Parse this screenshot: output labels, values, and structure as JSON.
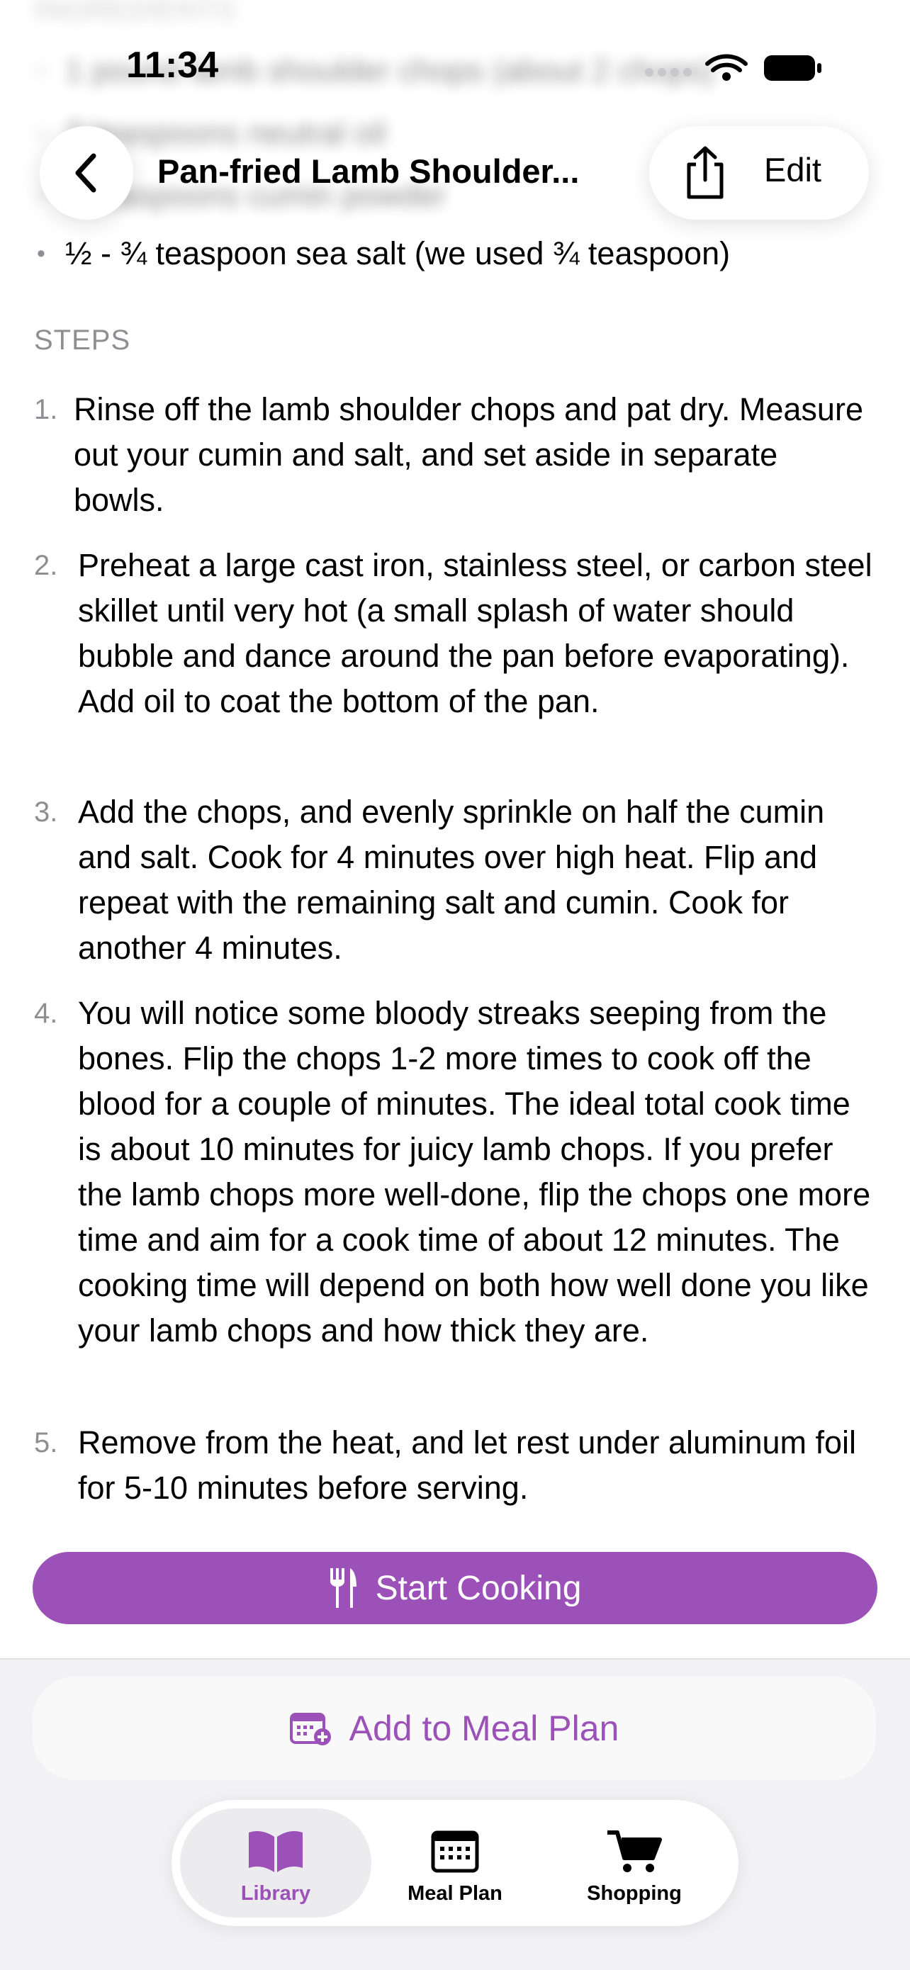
{
  "status_bar": {
    "time": "11:34"
  },
  "nav": {
    "title": "Pan-fried Lamb Shoulder...",
    "edit_label": "Edit"
  },
  "ingredients": {
    "header": "INGREDIENTS",
    "items": [
      "1 pound lamb shoulder chops (about 2 chops)",
      "2 teaspoons neutral oil",
      "2 teaspoons cumin powder",
      "½ - ¾ teaspoon sea salt (we used ¾ teaspoon)"
    ]
  },
  "steps": {
    "header": "STEPS",
    "items": [
      {
        "num": "1.",
        "text": "Rinse off the lamb shoulder chops and pat dry. Measure out your cumin and salt, and set aside in separate bowls."
      },
      {
        "num": "2.",
        "text": "Preheat a large cast iron, stainless steel, or carbon steel skillet until very hot (a small splash of water should bubble and dance around the pan before evaporating). Add oil to coat the bottom of the pan."
      },
      {
        "num": "3.",
        "text": "Add the chops, and evenly sprinkle on half the cumin and salt. Cook for 4 minutes over high heat. Flip and repeat with the remaining salt and cumin. Cook for another 4 minutes."
      },
      {
        "num": "4.",
        "text": "You will notice some bloody streaks seeping from the bones. Flip the chops 1-2 more times to cook off the blood for a couple of minutes. The ideal total cook time is about 10 minutes for juicy lamb chops. If you prefer the lamb chops more well-done, flip the chops one more time and aim for a cook time of about 12 minutes. The cooking time will depend on both how well done you like your lamb chops and how thick they are."
      },
      {
        "num": "5.",
        "text": "Remove from the heat, and let rest under aluminum foil for 5-10 minutes before serving."
      }
    ]
  },
  "actions": {
    "start_cooking": "Start Cooking",
    "add_to_meal_plan": "Add to Meal Plan"
  },
  "tabs": [
    {
      "label": "Library",
      "icon": "book-icon",
      "active": true
    },
    {
      "label": "Meal Plan",
      "icon": "calendar-icon",
      "active": false
    },
    {
      "label": "Shopping",
      "icon": "cart-icon",
      "active": false
    }
  ],
  "colors": {
    "accent": "#9b51b8",
    "secondary_text": "#8e8e93",
    "bar_bg": "#f2f2f4"
  }
}
